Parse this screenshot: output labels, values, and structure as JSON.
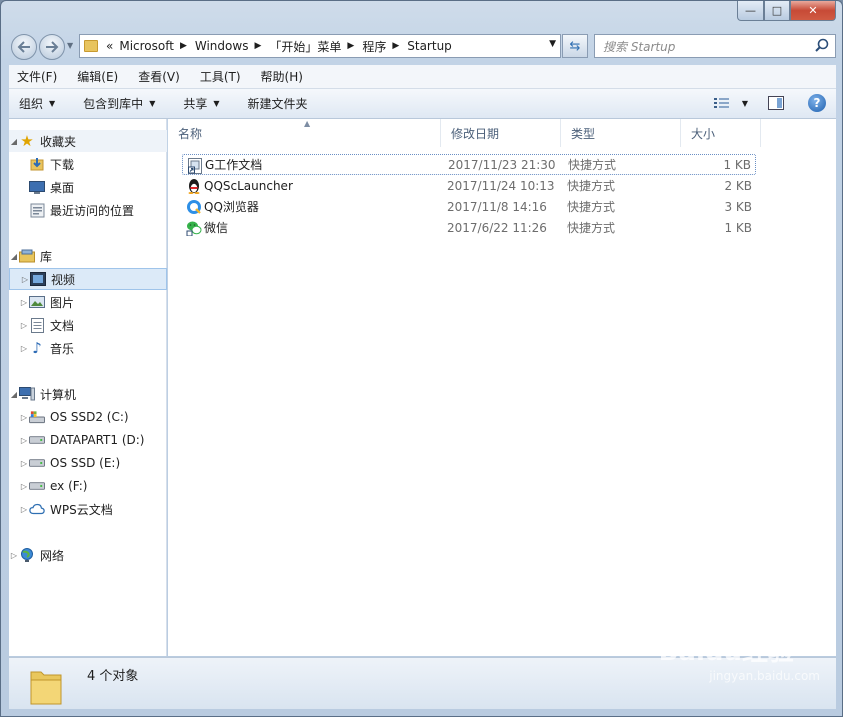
{
  "window": {
    "caption": {
      "minimize": "—",
      "maximize": "□",
      "close": "✕"
    }
  },
  "address": {
    "prefix": "«",
    "crumbs": [
      "Microsoft",
      "Windows",
      "「开始」菜单",
      "程序",
      "Startup"
    ]
  },
  "search": {
    "placeholder": "搜索 Startup"
  },
  "menubar": {
    "items": [
      "文件(F)",
      "编辑(E)",
      "查看(V)",
      "工具(T)",
      "帮助(H)"
    ]
  },
  "toolbar": {
    "organize": "组织",
    "include_in_library": "包含到库中",
    "share": "共享",
    "new_folder": "新建文件夹"
  },
  "navigation": {
    "favorites": {
      "label": "收藏夹",
      "items": [
        "下载",
        "桌面",
        "最近访问的位置"
      ]
    },
    "libraries": {
      "label": "库",
      "items": [
        "视频",
        "图片",
        "文档",
        "音乐"
      ],
      "selected": "视频"
    },
    "computer": {
      "label": "计算机",
      "items": [
        "OS SSD2 (C:)",
        "DATAPART1 (D:)",
        "OS SSD (E:)",
        "ex (F:)",
        "WPS云文档"
      ]
    },
    "network": {
      "label": "网络"
    }
  },
  "columns": {
    "name": "名称",
    "date": "修改日期",
    "type": "类型",
    "size": "大小"
  },
  "files": [
    {
      "name": "G工作文档",
      "date": "2017/11/23 21:30",
      "type": "快捷方式",
      "size": "1 KB",
      "icon": "shortcut-doc-icon"
    },
    {
      "name": "QQScLauncher",
      "date": "2017/11/24 10:13",
      "type": "快捷方式",
      "size": "2 KB",
      "icon": "qq-penguin-icon"
    },
    {
      "name": "QQ浏览器",
      "date": "2017/11/8 14:16",
      "type": "快捷方式",
      "size": "3 KB",
      "icon": "qq-browser-icon"
    },
    {
      "name": "微信",
      "date": "2017/6/22 11:26",
      "type": "快捷方式",
      "size": "1 KB",
      "icon": "wechat-icon"
    }
  ],
  "status": {
    "count": "4 个对象"
  },
  "watermark": {
    "main": "Baidu经验",
    "sub": "jingyan.baidu.com"
  },
  "colors": {
    "selection": "#dceaf8",
    "chrome": "#c2d3e6",
    "close": "#c74a36"
  }
}
